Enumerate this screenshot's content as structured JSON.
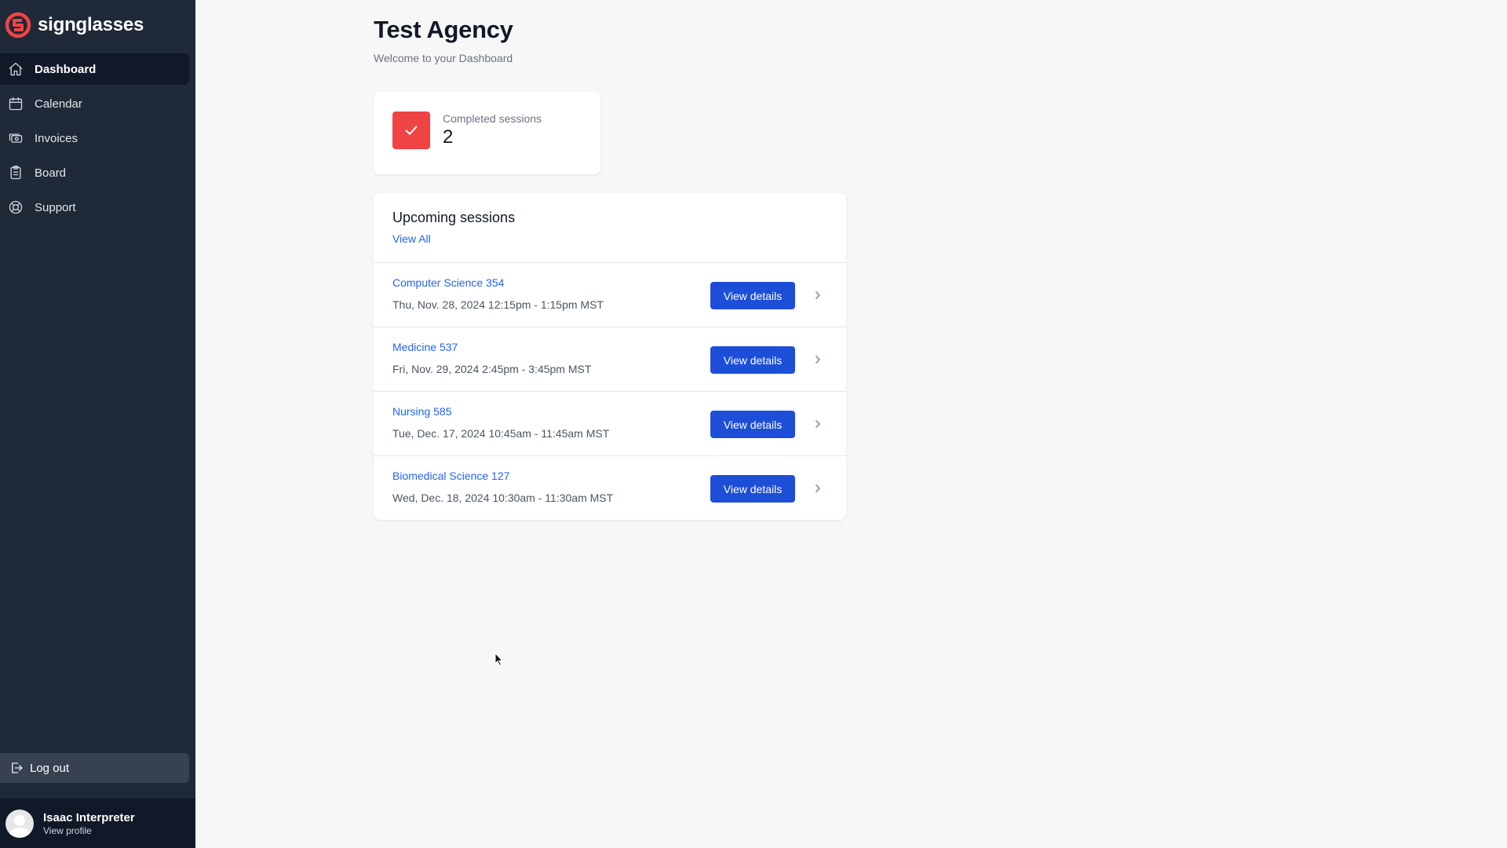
{
  "brand": {
    "name": "signglasses",
    "accent": "#ef4444"
  },
  "sidebar": {
    "items": [
      {
        "label": "Dashboard",
        "icon": "home-icon",
        "active": true
      },
      {
        "label": "Calendar",
        "icon": "calendar-icon",
        "active": false
      },
      {
        "label": "Invoices",
        "icon": "cash-icon",
        "active": false
      },
      {
        "label": "Board",
        "icon": "clipboard-icon",
        "active": false
      },
      {
        "label": "Support",
        "icon": "lifebuoy-icon",
        "active": false
      }
    ],
    "logout_label": "Log out",
    "user": {
      "name": "Isaac Interpreter",
      "link": "View profile"
    }
  },
  "header": {
    "title": "Test Agency",
    "subtitle": "Welcome to your Dashboard"
  },
  "stats": {
    "completed_label": "Completed sessions",
    "completed_value": "2"
  },
  "upcoming": {
    "title": "Upcoming sessions",
    "view_all": "View All",
    "button_label": "View details",
    "sessions": [
      {
        "title": "Computer Science 354",
        "time": "Thu, Nov. 28, 2024 12:15pm - 1:15pm MST"
      },
      {
        "title": "Medicine 537",
        "time": "Fri, Nov. 29, 2024 2:45pm - 3:45pm MST"
      },
      {
        "title": "Nursing 585",
        "time": "Tue, Dec. 17, 2024 10:45am - 11:45am MST"
      },
      {
        "title": "Biomedical Science 127",
        "time": "Wed, Dec. 18, 2024 10:30am - 11:30am MST"
      }
    ]
  }
}
